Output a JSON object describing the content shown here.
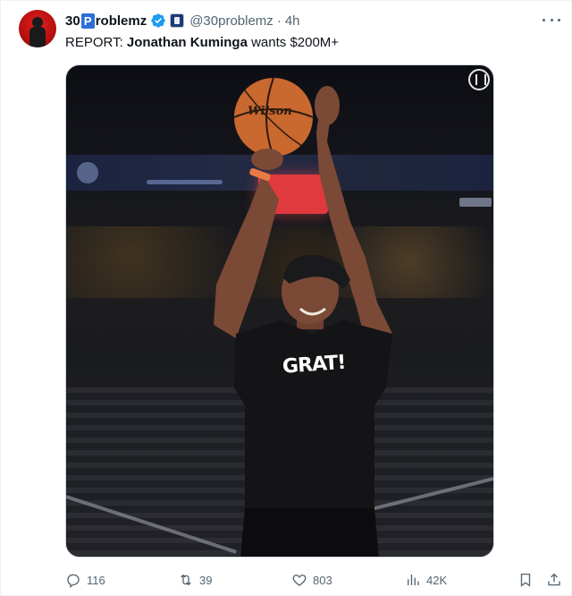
{
  "tweet": {
    "display_name_prefix": "30",
    "display_name_box": "P",
    "display_name_suffix": "roblemz",
    "handle": "@30problemz",
    "separator": "·",
    "time": "4h",
    "text_prefix": "REPORT: ",
    "text_bold": "Jonathan Kuminga",
    "text_suffix": " wants $200M+"
  },
  "media": {
    "ball_brand": "Wilson",
    "shirt_text": "GRAT!"
  },
  "actions": {
    "replies": "116",
    "retweets": "39",
    "likes": "803",
    "views": "42K"
  },
  "icons": {
    "verified": "verified-badge-icon",
    "affiliate": "affiliate-badge-icon",
    "more": "more-icon",
    "reply": "reply-icon",
    "retweet": "retweet-icon",
    "like": "heart-icon",
    "views": "views-icon",
    "bookmark": "bookmark-icon",
    "share": "share-icon"
  },
  "colors": {
    "verified_blue": "#1d9bf0",
    "text_primary": "#0f1419",
    "text_secondary": "#536471",
    "name_box_blue": "#2d6fd6"
  }
}
